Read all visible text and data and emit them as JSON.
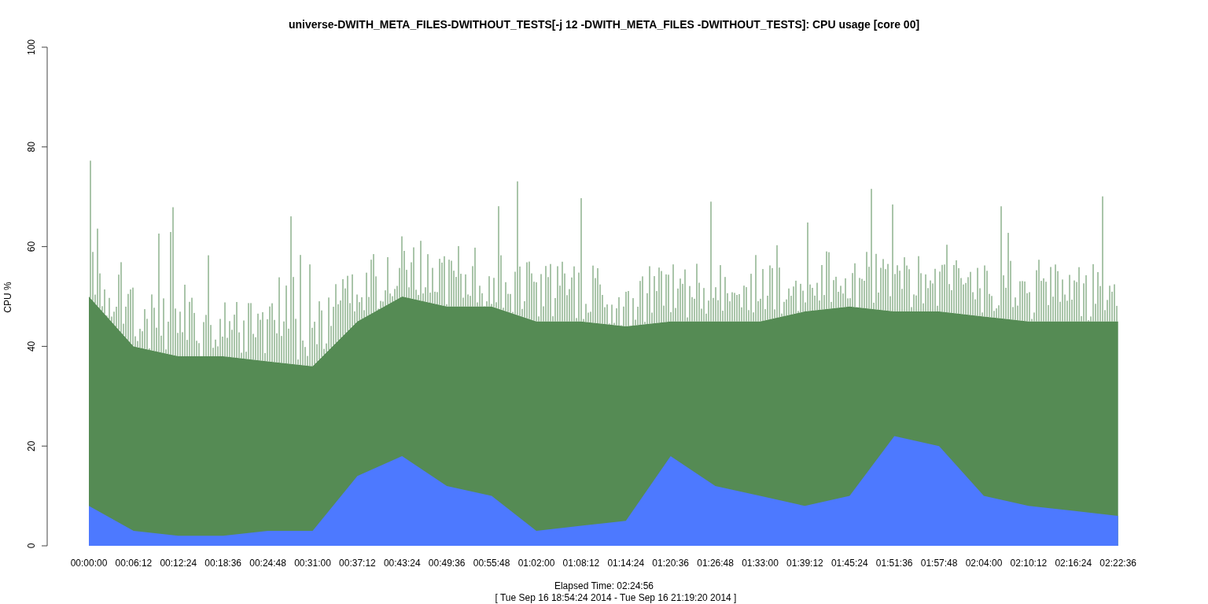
{
  "chart_data": {
    "type": "area",
    "title": "universe-DWITH_META_FILES-DWITHOUT_TESTS[-j 12 -DWITH_META_FILES -DWITHOUT_TESTS]: CPU usage [core 00]",
    "xlabel": "Elapsed Time: 02:24:56\n[ Tue Sep 16 18:54:24 2014 - Tue Sep 16 21:19:20 2014 ]",
    "ylabel": "CPU %",
    "ylim": [
      0,
      100
    ],
    "yticks": [
      0,
      20,
      40,
      60,
      80,
      100
    ],
    "categories": [
      "00:00:00",
      "00:06:12",
      "00:12:24",
      "00:18:36",
      "00:24:48",
      "00:31:00",
      "00:37:12",
      "00:43:24",
      "00:49:36",
      "00:55:48",
      "01:02:00",
      "01:08:12",
      "01:14:24",
      "01:20:36",
      "01:26:48",
      "01:33:00",
      "01:39:12",
      "01:45:24",
      "01:51:36",
      "01:57:48",
      "02:04:00",
      "02:10:12",
      "02:16:24",
      "02:22:36"
    ],
    "stacked": false,
    "series": [
      {
        "color": "#558b54",
        "values": [
          50,
          40,
          38,
          38,
          37,
          36,
          45,
          50,
          48,
          48,
          45,
          45,
          44,
          45,
          45,
          45,
          47,
          48,
          47,
          47,
          46,
          45,
          45,
          45
        ]
      },
      {
        "color": "#4d79ff",
        "values": [
          8,
          3,
          2,
          2,
          3,
          3,
          14,
          18,
          12,
          10,
          3,
          4,
          5,
          18,
          12,
          10,
          8,
          10,
          22,
          20,
          10,
          8,
          7,
          6
        ]
      }
    ]
  }
}
